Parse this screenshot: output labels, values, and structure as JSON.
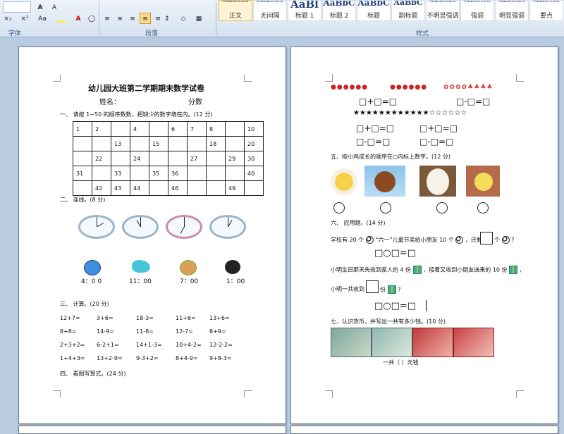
{
  "ribbon": {
    "groups": {
      "font": "字体",
      "paragraph": "段落",
      "styles": "样式"
    },
    "styles": [
      {
        "preview": "AaBbCcDd",
        "name": "正文",
        "selected": true
      },
      {
        "preview": "AaBbCcDd",
        "name": "无间隔"
      },
      {
        "preview": "AaBl",
        "name": "标题 1"
      },
      {
        "preview": "AaBbC",
        "name": "标题 2"
      },
      {
        "preview": "AaBbC",
        "name": "标题"
      },
      {
        "preview": "AaBbC",
        "name": "副标题"
      },
      {
        "preview": "AaBbCcDd",
        "name": "不明显强调"
      },
      {
        "preview": "AaBbCcDd",
        "name": "强调"
      },
      {
        "preview": "AaBbCcDd",
        "name": "明显强调"
      },
      {
        "preview": "AaBbCcDd",
        "name": "要点"
      }
    ],
    "font_buttons": [
      "A",
      "A",
      "×₂",
      "×²",
      "Aa"
    ],
    "accent": "#fbd989"
  },
  "left_page": {
    "title": "幼儿园大班第二学期期末数学试卷",
    "name_label": "姓名：",
    "score_label": "分数",
    "q1": "一、  请按 1~50 的顺序数数，把缺少的数字填在内。(12 分)",
    "grid": [
      [
        "1",
        "2",
        "",
        "4",
        "",
        "6",
        "7",
        "8",
        "",
        "10"
      ],
      [
        "",
        "",
        "13",
        "",
        "15",
        "",
        "",
        "18",
        "",
        "20"
      ],
      [
        "",
        "22",
        "",
        "24",
        "",
        "",
        "27",
        "",
        "29",
        "30"
      ],
      [
        "31",
        "",
        "33",
        "",
        "35",
        "36",
        "",
        "",
        "",
        "40"
      ],
      [
        "",
        "42",
        "43",
        "44",
        "",
        "46",
        "",
        "",
        "49",
        ""
      ]
    ],
    "q2": "二、  连线。(8 分)",
    "times": [
      "4：0 0",
      "11：00",
      "7：00",
      "1：00"
    ],
    "q3": "三、  计算。(20 分)",
    "calc": [
      [
        "12+7=",
        "3+6=",
        "18-3=",
        "11+6=",
        "13+6="
      ],
      [
        "8+8=",
        "14-9=",
        "11-8=",
        "12-7=",
        "8+9="
      ],
      [
        "2+3+2=",
        "6-2+1=",
        "14+1-3=",
        "10+4-2=",
        "12-2-2="
      ],
      [
        "1+4+3=",
        "13+2-9=",
        "9-3+2=",
        "8+4-9=",
        "9+8-3="
      ]
    ],
    "q4": "四、  看图写算式。(24 分)"
  },
  "right_page": {
    "eq_row1_left": "□+□=□",
    "eq_row1_right": "□-□=□",
    "stars": "★★★★★★★★★★★★☆☆☆☆☆☆",
    "eq_row2": [
      "□+□=□",
      "□+□=□"
    ],
    "eq_row3": [
      "□-□=□",
      "□-□=□"
    ],
    "q5": "五、按小鸡成长的顺序在○内标上数字。(12 分)",
    "q6": "六、  应用题。(14 分)",
    "p1a": "学校有 20 个",
    "p1b": "“六一”儿童节奖给小朋友 10 个",
    "p1c": "，还剩",
    "p1d": "个",
    "p1e": "?",
    "eq1": "□○□=□",
    "p2a": "小明生日那天先收到家人的 4 份",
    "p2b": "，接着又收到小朋友送来的 10 份",
    "p2c": "，",
    "p3a": "小明一共收到",
    "p3b": "份",
    "p3c": "?",
    "eq2": "□○□=□",
    "q7": "七、认识货币，并写出一共有多少钱。(10 分)",
    "total": "一共（      ）元钱"
  }
}
